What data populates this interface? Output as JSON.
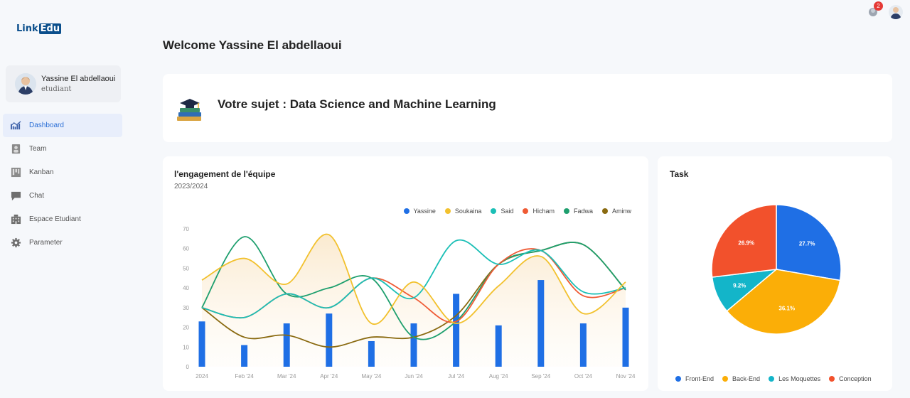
{
  "app": {
    "logo_part1": "Link",
    "logo_part2": "Edu"
  },
  "header": {
    "notification_count": "2",
    "welcome": "Welcome Yassine El abdellaoui"
  },
  "profile": {
    "name": "Yassine El abdellaoui",
    "role": "etudiant"
  },
  "sidebar": {
    "items": [
      {
        "label": "Dashboard",
        "icon": "chart-line-icon",
        "active": true
      },
      {
        "label": "Team",
        "icon": "team-icon",
        "active": false
      },
      {
        "label": "Kanban",
        "icon": "kanban-icon",
        "active": false
      },
      {
        "label": "Chat",
        "icon": "chat-icon",
        "active": false
      },
      {
        "label": "Espace Etudiant",
        "icon": "building-icon",
        "active": false
      },
      {
        "label": "Parameter",
        "icon": "gear-icon",
        "active": false
      }
    ]
  },
  "subject": {
    "text": "Votre sujet : Data Science and Machine Learning",
    "icon": "books-graduation-icon"
  },
  "engagement": {
    "title": "l'engagement de l'équipe",
    "subtitle": "2023/2024"
  },
  "task": {
    "title": "Task"
  },
  "colors": {
    "accent": "#2b6fd6",
    "badge": "#e53935"
  },
  "chart_data": [
    {
      "type": "line",
      "title": "l'engagement de l'équipe",
      "subtitle": "2023/2024",
      "categories": [
        "2024",
        "Feb '24",
        "Mar '24",
        "Apr '24",
        "May '24",
        "Jun '24",
        "Jul '24",
        "Aug '24",
        "Sep '24",
        "Oct '24",
        "Nov '24"
      ],
      "ylim": [
        0,
        70
      ],
      "yticks": [
        0,
        10,
        20,
        30,
        40,
        50,
        60,
        70
      ],
      "legend_position": "top-right",
      "series": [
        {
          "name": "Yassine",
          "kind": "bar",
          "color": "#1f6fe5",
          "values": [
            23,
            11,
            22,
            27,
            13,
            22,
            37,
            21,
            44,
            22,
            30
          ]
        },
        {
          "name": "Soukaina",
          "kind": "area",
          "color": "#f2c12e",
          "values": [
            44,
            55,
            42,
            67,
            22,
            43,
            22,
            41,
            56,
            27,
            43
          ]
        },
        {
          "name": "Said",
          "kind": "line",
          "color": "#1bbfb6",
          "values": [
            30,
            25,
            37,
            30,
            45,
            35,
            64,
            52,
            59,
            38,
            40
          ]
        },
        {
          "name": "Hicham",
          "kind": "line",
          "color": "#ef5a34",
          "values": [
            30,
            25,
            37,
            30,
            45,
            35,
            23,
            52,
            59,
            36,
            40
          ]
        },
        {
          "name": "Fadwa",
          "kind": "line",
          "color": "#1e9f6e",
          "values": [
            30,
            66,
            37,
            40,
            45,
            15,
            23,
            52,
            59,
            62,
            39
          ]
        },
        {
          "name": "Aminw",
          "kind": "line",
          "color": "#8a6a10",
          "values": [
            30,
            15,
            16,
            10,
            15,
            15,
            26,
            52,
            59,
            62,
            39
          ]
        }
      ]
    },
    {
      "type": "pie",
      "title": "Task",
      "legend_position": "bottom",
      "slices": [
        {
          "label": "Front-End",
          "value": 27.7,
          "display": "27.7%",
          "color": "#1f6fe5"
        },
        {
          "label": "Back-End",
          "value": 36.1,
          "display": "36.1%",
          "color": "#fbae07"
        },
        {
          "label": "Les Moquettes",
          "value": 9.2,
          "display": "9.2%",
          "color": "#13b5c9"
        },
        {
          "label": "Conception",
          "value": 26.9,
          "display": "26.9%",
          "color": "#f2512c"
        }
      ]
    }
  ]
}
